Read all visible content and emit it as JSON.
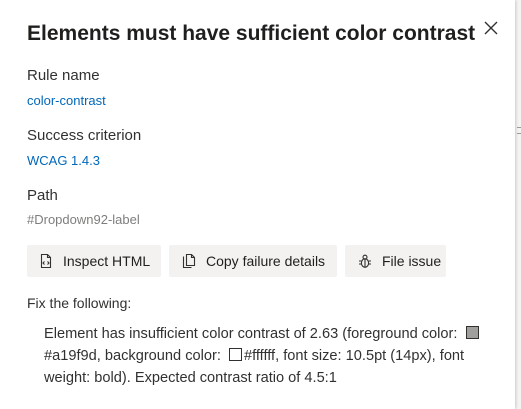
{
  "panel": {
    "title": "Elements must have sufficient color contrast",
    "close_icon": "close-icon"
  },
  "rule": {
    "label": "Rule name",
    "value": "color-contrast"
  },
  "criterion": {
    "label": "Success criterion",
    "value": "WCAG 1.4.3"
  },
  "path": {
    "label": "Path",
    "value": "#Dropdown92-label"
  },
  "actions": {
    "inspect_label": "Inspect HTML",
    "inspect_icon": "inspect-html-icon",
    "copy_label": "Copy failure details",
    "copy_icon": "copy-icon",
    "file_label": "File issue",
    "file_icon": "bug-icon"
  },
  "fix": {
    "label": "Fix the following:",
    "text_1": "Element has insufficient color contrast of 2.63 (foreground color:",
    "foreground_color": "#a19f9d",
    "text_2": ", background color:",
    "background_color": "#ffffff",
    "text_3": ", font size: 10.5pt (14px), font weight: bold). Expected contrast ratio of 4.5:1"
  },
  "colors": {
    "link": "#0067b8",
    "button_bg": "#f3f2f1",
    "text": "#323130",
    "muted": "#807e7c"
  }
}
